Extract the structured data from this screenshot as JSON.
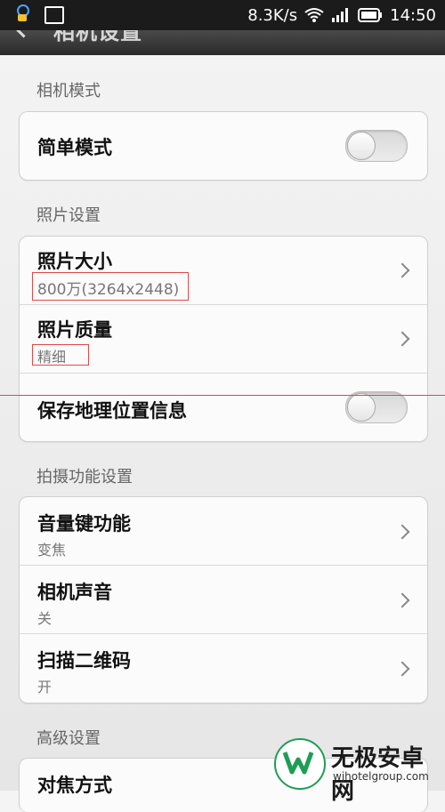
{
  "status_bar": {
    "network_speed": "8.3K/s",
    "time": "14:50",
    "icons": [
      "notification-icon",
      "image-icon",
      "wifi-icon",
      "signal-icon",
      "battery-icon"
    ]
  },
  "header": {
    "title": "相机设置",
    "back_icon": "back-arrow-icon"
  },
  "sections": {
    "camera_mode": {
      "label": "相机模式",
      "items": [
        {
          "title": "简单模式",
          "type": "toggle",
          "state": "off"
        }
      ]
    },
    "photo_settings": {
      "label": "照片设置",
      "items": [
        {
          "title": "照片大小",
          "value": "800万(3264x2448)",
          "type": "chevron"
        },
        {
          "title": "照片质量",
          "value": "精细",
          "type": "chevron"
        },
        {
          "title": "保存地理位置信息",
          "type": "toggle",
          "state": "off"
        }
      ]
    },
    "capture_settings": {
      "label": "拍摄功能设置",
      "items": [
        {
          "title": "音量键功能",
          "value": "变焦",
          "type": "chevron"
        },
        {
          "title": "相机声音",
          "value": "关",
          "type": "chevron"
        },
        {
          "title": "扫描二维码",
          "value": "开",
          "type": "chevron"
        }
      ]
    },
    "advanced": {
      "label": "高级设置",
      "items": [
        {
          "title": "对焦方式",
          "type": "chevron"
        }
      ]
    }
  },
  "watermark": {
    "title": "无极安卓网",
    "url": "wjhotelgroup.com"
  },
  "colors": {
    "annotation_red": "#e04848",
    "status_bar": "#1b1b1b",
    "brand_green": "#1f9d55"
  }
}
